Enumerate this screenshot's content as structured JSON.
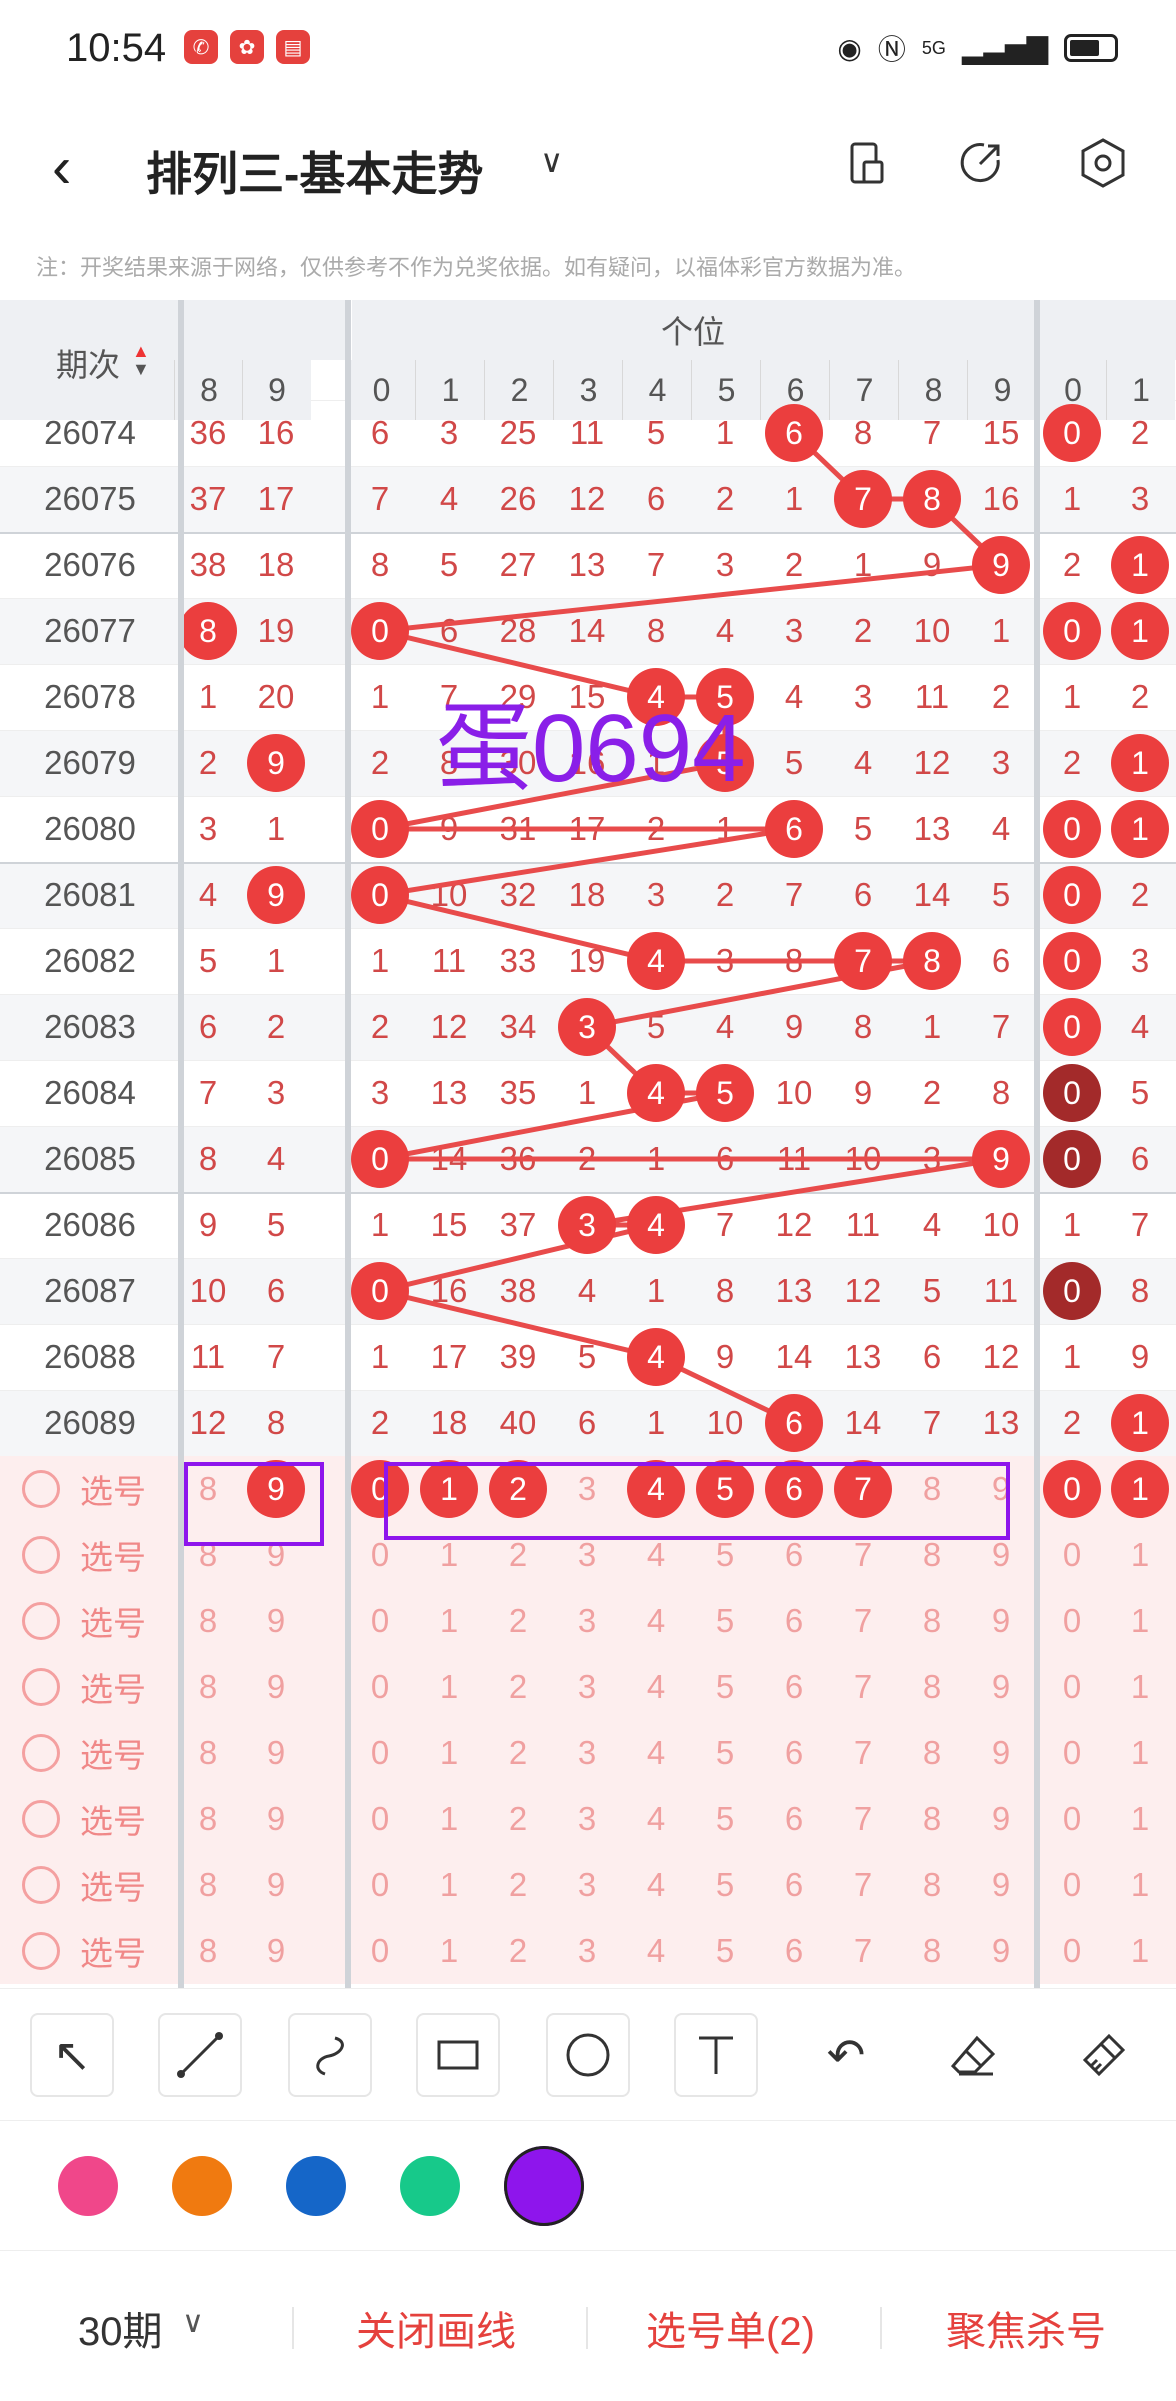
{
  "status_bar": {
    "time": "10:54",
    "signal": "5G"
  },
  "header": {
    "title": "排列三-基本走势"
  },
  "notice": "注：开奖结果来源于网络，仅供参考不作为兑奖依据。如有疑问，以福体彩官方数据为准。",
  "table": {
    "period_header": "期次",
    "group_header": "个位",
    "left_digit_headers": [
      "8",
      "9"
    ],
    "digit_headers": [
      "0",
      "1",
      "2",
      "3",
      "4",
      "5",
      "6",
      "7",
      "8",
      "9"
    ],
    "right_digit_headers": [
      "0",
      "1"
    ],
    "rows": [
      {
        "period": "26074",
        "left": [
          "36",
          "16"
        ],
        "digits": [
          "6",
          "3",
          "25",
          "11",
          "5",
          "1",
          "6",
          "8",
          "7",
          "15"
        ],
        "right": [
          "0",
          "2"
        ]
      },
      {
        "period": "26075",
        "left": [
          "37",
          "17"
        ],
        "digits": [
          "7",
          "4",
          "26",
          "12",
          "6",
          "2",
          "1",
          "7",
          "8",
          "16"
        ],
        "right": [
          "1",
          "3"
        ]
      },
      {
        "period": "26076",
        "left": [
          "38",
          "18"
        ],
        "digits": [
          "8",
          "5",
          "27",
          "13",
          "7",
          "3",
          "2",
          "1",
          "9",
          "9"
        ],
        "right": [
          "2",
          "1"
        ]
      },
      {
        "period": "26077",
        "left": [
          "8",
          "19"
        ],
        "digits": [
          "0",
          "6",
          "28",
          "14",
          "8",
          "4",
          "3",
          "2",
          "10",
          "1"
        ],
        "right": [
          "0",
          "1"
        ]
      },
      {
        "period": "26078",
        "left": [
          "1",
          "20"
        ],
        "digits": [
          "1",
          "7",
          "29",
          "15",
          "4",
          "5",
          "4",
          "3",
          "11",
          "2"
        ],
        "right": [
          "1",
          "2"
        ]
      },
      {
        "period": "26079",
        "left": [
          "2",
          "9"
        ],
        "digits": [
          "2",
          "8",
          "30",
          "16",
          "1",
          "5",
          "5",
          "4",
          "12",
          "3"
        ],
        "right": [
          "2",
          "1"
        ]
      },
      {
        "period": "26080",
        "left": [
          "3",
          "1"
        ],
        "digits": [
          "0",
          "9",
          "31",
          "17",
          "2",
          "1",
          "6",
          "5",
          "13",
          "4"
        ],
        "right": [
          "0",
          "1"
        ]
      },
      {
        "period": "26081",
        "left": [
          "4",
          "9"
        ],
        "digits": [
          "0",
          "10",
          "32",
          "18",
          "3",
          "2",
          "7",
          "6",
          "14",
          "5"
        ],
        "right": [
          "0",
          "2"
        ]
      },
      {
        "period": "26082",
        "left": [
          "5",
          "1"
        ],
        "digits": [
          "1",
          "11",
          "33",
          "19",
          "4",
          "3",
          "8",
          "7",
          "8",
          "6"
        ],
        "right": [
          "0",
          "3"
        ]
      },
      {
        "period": "26083",
        "left": [
          "6",
          "2"
        ],
        "digits": [
          "2",
          "12",
          "34",
          "3",
          "5",
          "4",
          "9",
          "8",
          "1",
          "7"
        ],
        "right": [
          "0",
          "4"
        ]
      },
      {
        "period": "26084",
        "left": [
          "7",
          "3"
        ],
        "digits": [
          "3",
          "13",
          "35",
          "1",
          "4",
          "5",
          "10",
          "9",
          "2",
          "8"
        ],
        "right": [
          "0",
          "5"
        ]
      },
      {
        "period": "26085",
        "left": [
          "8",
          "4"
        ],
        "digits": [
          "0",
          "14",
          "36",
          "2",
          "1",
          "6",
          "11",
          "10",
          "3",
          "9"
        ],
        "right": [
          "0",
          "6"
        ]
      },
      {
        "period": "26086",
        "left": [
          "9",
          "5"
        ],
        "digits": [
          "1",
          "15",
          "37",
          "3",
          "4",
          "7",
          "12",
          "11",
          "4",
          "10"
        ],
        "right": [
          "1",
          "7"
        ]
      },
      {
        "period": "26087",
        "left": [
          "10",
          "6"
        ],
        "digits": [
          "0",
          "16",
          "38",
          "4",
          "1",
          "8",
          "13",
          "12",
          "5",
          "11"
        ],
        "right": [
          "0",
          "8"
        ]
      },
      {
        "period": "26088",
        "left": [
          "11",
          "7"
        ],
        "digits": [
          "1",
          "17",
          "39",
          "5",
          "4",
          "9",
          "14",
          "13",
          "6",
          "12"
        ],
        "right": [
          "1",
          "9"
        ]
      },
      {
        "period": "26089",
        "left": [
          "12",
          "8"
        ],
        "digits": [
          "2",
          "18",
          "40",
          "6",
          "1",
          "10",
          "6",
          "14",
          "7",
          "13"
        ],
        "right": [
          "2",
          "1"
        ]
      }
    ],
    "picker_label": "选号",
    "picker_rows": 8
  },
  "annotation_text": "蛋0694",
  "tools": [
    "arrow",
    "line",
    "curve",
    "rectangle",
    "ellipse",
    "text",
    "undo",
    "eraser",
    "clear"
  ],
  "palette": [
    "#f0478a",
    "#f07a10",
    "#1566c8",
    "#17c98a",
    "#8e15ec"
  ],
  "selected_color": "#8e15ec",
  "bottom_bar": {
    "period_select": "30期",
    "close_draw": "关闭画线",
    "pick_list": "选号单(2)",
    "focus_kill": "聚焦杀号"
  },
  "colors": {
    "accent": "#eb3e3e",
    "annotation": "#8e15ec",
    "dark_ball": "#a32a2a"
  }
}
